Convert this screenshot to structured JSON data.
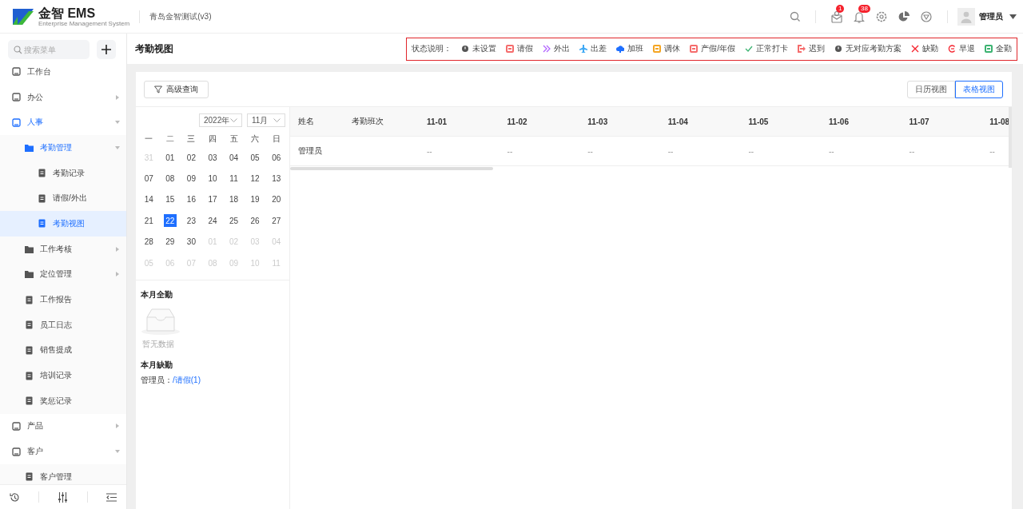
{
  "header": {
    "brand": "金智 EMS",
    "brand_subtitle": "Enterprise Management System",
    "tenant": "青岛金智测试(v3)",
    "badges": [
      "1",
      "38"
    ],
    "user": "管理员"
  },
  "sidebar": {
    "search": {
      "placeholder": "搜索菜单"
    },
    "items": [
      {
        "label": "工作台",
        "selected": false
      },
      {
        "label": "办公",
        "expanded": false,
        "selected": false
      },
      {
        "label": "人事",
        "expanded": true,
        "selected": false,
        "children": [
          {
            "label": "考勤管理",
            "expanded": true,
            "selected": false,
            "children": [
              {
                "label": "考勤记录",
                "selected": false
              },
              {
                "label": "请假/外出",
                "selected": false
              },
              {
                "label": "考勤视图",
                "selected": true
              }
            ]
          },
          {
            "label": "工作考核",
            "expanded": false,
            "selected": false
          },
          {
            "label": "定位管理",
            "expanded": false,
            "selected": false
          },
          {
            "label": "工作报告",
            "selected": false
          },
          {
            "label": "员工日志",
            "selected": false
          },
          {
            "label": "销售提成",
            "selected": false
          },
          {
            "label": "培训记录",
            "selected": false
          },
          {
            "label": "奖惩记录",
            "selected": false
          }
        ]
      },
      {
        "label": "产品",
        "expanded": false,
        "selected": false
      },
      {
        "label": "客户",
        "expanded": true,
        "selected": false,
        "children": [
          {
            "label": "客户管理",
            "selected": false
          }
        ]
      }
    ]
  },
  "page": {
    "title": "考勤视图"
  },
  "legend": {
    "label": "状态说明：",
    "items": [
      {
        "label": "未设置",
        "kind": "dot",
        "color": "#555555"
      },
      {
        "label": "请假",
        "kind": "box",
        "color": "#f56c6c"
      },
      {
        "label": "外出",
        "kind": "chevron",
        "color": "#b062ff"
      },
      {
        "label": "出差",
        "kind": "plane",
        "color": "#3fa9f5"
      },
      {
        "label": "加班",
        "kind": "cloud",
        "color": "#1e6fff"
      },
      {
        "label": "调休",
        "kind": "box",
        "color": "#f5a623"
      },
      {
        "label": "产假/年假",
        "kind": "box",
        "color": "#f56c6c"
      },
      {
        "label": "正常打卡",
        "kind": "check",
        "color": "#3cb371"
      },
      {
        "label": "迟到",
        "kind": "exit",
        "color": "#f56c6c"
      },
      {
        "label": "无对应考勤方案",
        "kind": "dot",
        "color": "#555555"
      },
      {
        "label": "缺勤",
        "kind": "cross",
        "color": "#f5222d"
      },
      {
        "label": "早退",
        "kind": "ring",
        "color": "#f5222d"
      },
      {
        "label": "全勤",
        "kind": "box",
        "color": "#3cb371"
      }
    ]
  },
  "toolbar": {
    "filter_button": "高级查询",
    "views": [
      {
        "label": "日历视图",
        "selected": false
      },
      {
        "label": "表格视图",
        "selected": true
      }
    ]
  },
  "calendar": {
    "year": "2022年",
    "month": "11月",
    "weekdays": [
      "一",
      "二",
      "三",
      "四",
      "五",
      "六",
      "日"
    ],
    "days": [
      {
        "day": "31",
        "muted": true,
        "selected": false
      },
      {
        "day": "01",
        "muted": false,
        "selected": false
      },
      {
        "day": "02",
        "muted": false,
        "selected": false
      },
      {
        "day": "03",
        "muted": false,
        "selected": false
      },
      {
        "day": "04",
        "muted": false,
        "selected": false
      },
      {
        "day": "05",
        "muted": false,
        "selected": false
      },
      {
        "day": "06",
        "muted": false,
        "selected": false
      },
      {
        "day": "07",
        "muted": false,
        "selected": false
      },
      {
        "day": "08",
        "muted": false,
        "selected": false
      },
      {
        "day": "09",
        "muted": false,
        "selected": false
      },
      {
        "day": "10",
        "muted": false,
        "selected": false
      },
      {
        "day": "11",
        "muted": false,
        "selected": false
      },
      {
        "day": "12",
        "muted": false,
        "selected": false
      },
      {
        "day": "13",
        "muted": false,
        "selected": false
      },
      {
        "day": "14",
        "muted": false,
        "selected": false
      },
      {
        "day": "15",
        "muted": false,
        "selected": false
      },
      {
        "day": "16",
        "muted": false,
        "selected": false
      },
      {
        "day": "17",
        "muted": false,
        "selected": false
      },
      {
        "day": "18",
        "muted": false,
        "selected": false
      },
      {
        "day": "19",
        "muted": false,
        "selected": false
      },
      {
        "day": "20",
        "muted": false,
        "selected": false
      },
      {
        "day": "21",
        "muted": false,
        "selected": false
      },
      {
        "day": "22",
        "muted": false,
        "selected": true
      },
      {
        "day": "23",
        "muted": false,
        "selected": false
      },
      {
        "day": "24",
        "muted": false,
        "selected": false
      },
      {
        "day": "25",
        "muted": false,
        "selected": false
      },
      {
        "day": "26",
        "muted": false,
        "selected": false
      },
      {
        "day": "27",
        "muted": false,
        "selected": false
      },
      {
        "day": "28",
        "muted": false,
        "selected": false
      },
      {
        "day": "29",
        "muted": false,
        "selected": false
      },
      {
        "day": "30",
        "muted": false,
        "selected": false
      },
      {
        "day": "01",
        "muted": true,
        "selected": false
      },
      {
        "day": "02",
        "muted": true,
        "selected": false
      },
      {
        "day": "03",
        "muted": true,
        "selected": false
      },
      {
        "day": "04",
        "muted": true,
        "selected": false
      },
      {
        "day": "05",
        "muted": true,
        "selected": false
      },
      {
        "day": "06",
        "muted": true,
        "selected": false
      },
      {
        "day": "07",
        "muted": true,
        "selected": false
      },
      {
        "day": "08",
        "muted": true,
        "selected": false
      },
      {
        "day": "09",
        "muted": true,
        "selected": false
      },
      {
        "day": "10",
        "muted": true,
        "selected": false
      },
      {
        "day": "11",
        "muted": true,
        "selected": false
      }
    ]
  },
  "summary": {
    "full_title": "本月全勤",
    "full_empty": "暂无数据",
    "absent_title": "本月缺勤",
    "absent_entries": [
      {
        "name": "管理员：",
        "link": "/请假(1)"
      }
    ]
  },
  "table": {
    "columns": [
      "姓名",
      "考勤班次",
      "11-01",
      "11-02",
      "11-03",
      "11-04",
      "11-05",
      "11-06",
      "11-07",
      "11-08"
    ],
    "rows": [
      {
        "cells": [
          "管理员",
          "",
          "--",
          "--",
          "--",
          "--",
          "--",
          "--",
          "--",
          "--"
        ]
      }
    ]
  }
}
